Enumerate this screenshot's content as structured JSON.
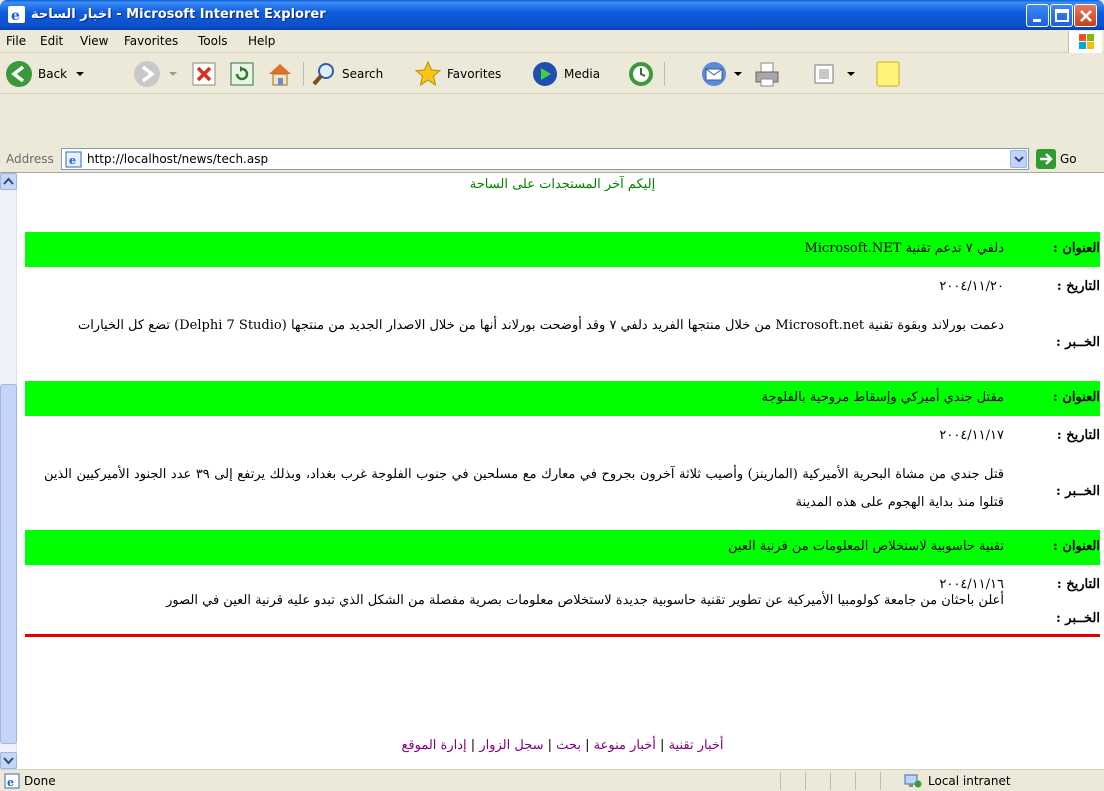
{
  "window": {
    "title": "اخبار الساحة - Microsoft Internet Explorer"
  },
  "menu": [
    "File",
    "Edit",
    "View",
    "Favorites",
    "Tools",
    "Help"
  ],
  "toolbar": {
    "back_label": "Back",
    "search_label": "Search",
    "favorites_label": "Favorites",
    "media_label": "Media"
  },
  "address": {
    "label": "Address",
    "url": "http://localhost/news/tech.asp",
    "go_label": "Go"
  },
  "page": {
    "headline": "إليكم آخر المستجدات على الساحة",
    "labels": {
      "title": "العنوان :",
      "date": "التاريخ :",
      "news": "الخــبر :"
    },
    "articles": [
      {
        "title": "دلفي ٧ تدعم تقنية Microsoft.NET",
        "date": "٢٠٠٤/١١/٢٠",
        "body": "دعمت بورلاند وبقوة تقنية Microsoft.net من خلال منتجها الفريد دلفي ٧ وقد أوضحت بورلاند أنها من خلال الاصدار الجديد من منتجها (Delphi 7 Studio) تضع كل الخيارات"
      },
      {
        "title": "مقتل جندي أميركي وإسقاط مروحية بالفلوجة",
        "date": "٢٠٠٤/١١/١٧",
        "body": "قتل جندي من مشاة البحرية الأميركية (المارينز) وأصيب ثلاثة آخرون بجروح في معارك مع مسلحين في جنوب الفلوجة غرب بغداد، وبذلك يرتفع إلى ٣٩ عدد الجنود الأميركيين الذين قتلوا منذ بداية الهجوم على هذه المدينة"
      },
      {
        "title": "تقنية حاسوبية لاستخلاص المعلومات من قرنية العين",
        "date": "٢٠٠٤/١١/١٦",
        "body": "أعلن باحثان من جامعة كولومبيا الأميركية عن تطوير تقنية حاسوبية جديدة لاستخلاص معلومات بصرية مفصلة من الشكل الذي تبدو عليه قرنية العين في الصور"
      }
    ],
    "footer_links": [
      "أخبار تقنية",
      "أخبار منوعة",
      "بحث",
      "سجل الزوار",
      "إدارة الموقع"
    ],
    "footer_separator": "|"
  },
  "status": {
    "text": "Done",
    "zone": "Local intranet"
  },
  "colors": {
    "title_highlight": "#00ff00",
    "headline": "#008000",
    "footer_links": "#800080",
    "rule": "#e00000"
  }
}
